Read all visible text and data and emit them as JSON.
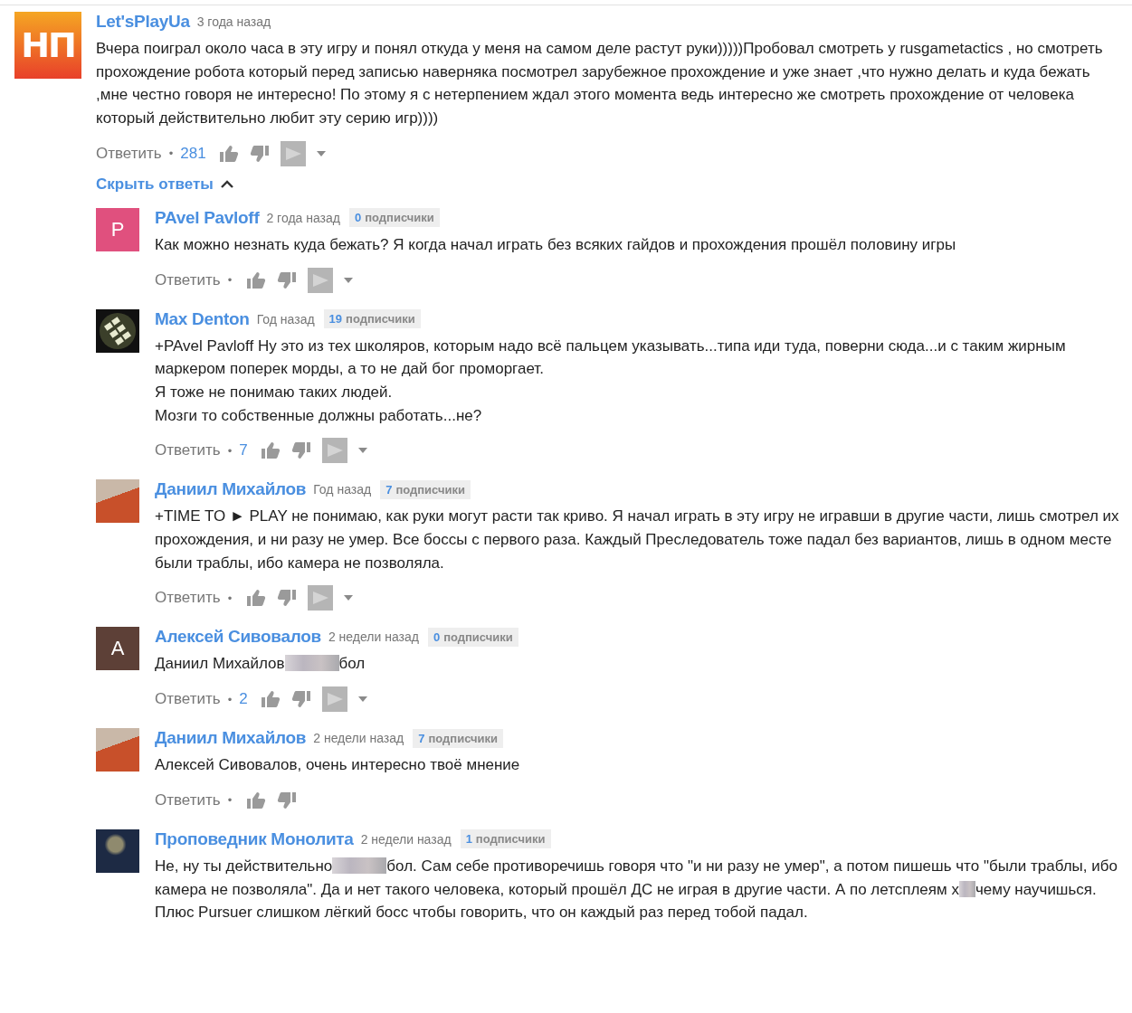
{
  "top_comment": {
    "avatar": {
      "kind": "logo",
      "text": "НП"
    },
    "author": "Let'sPlayUa",
    "time": "3 года назад",
    "body": [
      {
        "kind": "text",
        "text": "Вчера поиграл около часа в эту игру и понял откуда у меня на самом деле растут руки)))))Пробовал смотреть у rusgametactics , но смотреть прохождение робота который перед записью наверняка посмотрел зарубежное прохождение и уже знает ,что нужно делать и куда бежать ,мне честно говоря не интересно! По этому я с нетерпением ждал этого момента ведь интересно же смотреть прохождение от человека который действительно любит эту серию игр))))"
      }
    ],
    "actions": {
      "reply": "Ответить",
      "separator": "•",
      "score": "281",
      "icons": [
        {
          "kind": "like"
        },
        {
          "kind": "dislike"
        },
        {
          "kind": "flag"
        },
        {
          "kind": "menu"
        }
      ]
    }
  },
  "replies_toggle": {
    "label": "Скрыть ответы",
    "expanded": true
  },
  "replies": [
    {
      "avatar": {
        "kind": "letter",
        "text": "P",
        "color": "#e0507e"
      },
      "author": "PAvel Pavloff",
      "time": "2 года назад",
      "subscribers": {
        "count": "0",
        "label": "подписчики"
      },
      "body": [
        {
          "kind": "text",
          "text": "Как можно незнать куда бежать? Я когда начал играть без всяких гайдов и прохождения прошёл половину игры"
        }
      ],
      "actions": {
        "reply": "Ответить",
        "separator": "•",
        "icons": [
          {
            "kind": "like"
          },
          {
            "kind": "dislike"
          },
          {
            "kind": "flag"
          },
          {
            "kind": "menu"
          }
        ]
      }
    },
    {
      "avatar": {
        "kind": "pattern"
      },
      "author": "Max Denton",
      "time": "Год назад",
      "subscribers": {
        "count": "19",
        "label": "подписчики"
      },
      "body": [
        {
          "kind": "text",
          "text": "+PAvel Pavloff Ну это из тех школяров, которым надо всё пальцем указывать...типа иди туда, поверни сюда...и с таким жирным маркером поперек морды, а то не дай бог проморгает.\nЯ тоже не понимаю таких людей.\nМозги то собственные должны работать...не?"
        }
      ],
      "actions": {
        "reply": "Ответить",
        "separator": "•",
        "score": "7",
        "icons": [
          {
            "kind": "like"
          },
          {
            "kind": "dislike"
          },
          {
            "kind": "flag"
          },
          {
            "kind": "menu"
          }
        ]
      }
    },
    {
      "avatar": {
        "kind": "photo"
      },
      "author": "Даниил Михайлов",
      "time": "Год назад",
      "subscribers": {
        "count": "7",
        "label": "подписчики"
      },
      "body": [
        {
          "kind": "text",
          "text": "+TIME TO ► PLAY не понимаю, как руки могут расти так криво. Я начал играть в эту игру не игравши в другие части, лишь смотрел их прохождения, и ни разу не умер. Все боссы с первого раза. Каждый Преследователь тоже падал без вариантов, лишь в одном месте были траблы, ибо камера не позволяла."
        }
      ],
      "actions": {
        "reply": "Ответить",
        "separator": "•",
        "icons": [
          {
            "kind": "like"
          },
          {
            "kind": "dislike"
          },
          {
            "kind": "flag"
          },
          {
            "kind": "menu"
          }
        ]
      }
    },
    {
      "avatar": {
        "kind": "letter",
        "text": "А",
        "color": "#5d4037"
      },
      "author": "Алексей Сивовалов",
      "time": "2 недели назад",
      "subscribers": {
        "count": "0",
        "label": "подписчики"
      },
      "body": [
        {
          "kind": "text",
          "text": "Даниил Михайлов"
        },
        {
          "kind": "blur"
        },
        {
          "kind": "text",
          "text": "бол"
        }
      ],
      "actions": {
        "reply": "Ответить",
        "separator": "•",
        "score": "2",
        "icons": [
          {
            "kind": "like"
          },
          {
            "kind": "dislike"
          },
          {
            "kind": "flag"
          },
          {
            "kind": "menu"
          }
        ]
      }
    },
    {
      "avatar": {
        "kind": "photo"
      },
      "author": "Даниил Михайлов",
      "time": "2 недели назад",
      "subscribers": {
        "count": "7",
        "label": "подписчики"
      },
      "body": [
        {
          "kind": "text",
          "text": "Алексей Сивовалов, очень интересно твоё мнение"
        }
      ],
      "actions": {
        "reply": "Ответить",
        "separator": "•",
        "icons": [
          {
            "kind": "like"
          },
          {
            "kind": "dislike"
          }
        ]
      }
    },
    {
      "avatar": {
        "kind": "poster"
      },
      "author": "Проповедник Монолита",
      "time": "2 недели назад",
      "subscribers": {
        "count": "1",
        "label": "подписчики"
      },
      "body": [
        {
          "kind": "text",
          "text": "Не, ну ты действительно"
        },
        {
          "kind": "blur"
        },
        {
          "kind": "text",
          "text": "бол. Сам себе противоречишь говоря что \"и ни разу не умер\", а потом пишешь что \"были траблы, ибо камера не позволяла\". Да и нет такого человека, который прошёл ДС не играя в другие части. А по летсплеям х"
        },
        {
          "kind": "blurlet"
        },
        {
          "kind": "text",
          "text": "чему научишься. Плюс Pursuer слишком лёгкий босс чтобы говорить, что он каждый раз перед тобой падал."
        }
      ]
    }
  ]
}
